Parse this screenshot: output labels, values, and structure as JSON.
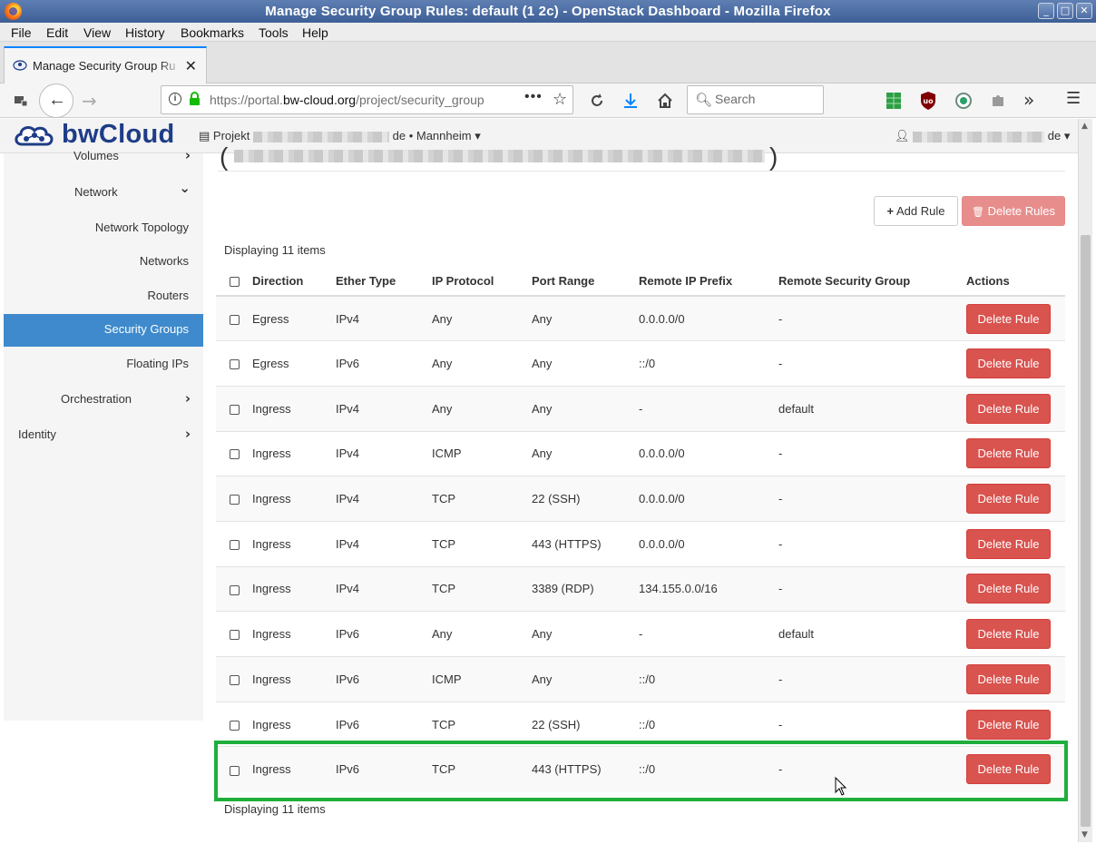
{
  "window": {
    "title": "Manage Security Group Rules: default (1                              2c) - OpenStack Dashboard - Mozilla Firefox",
    "buttons": [
      "_",
      "□",
      "✕"
    ]
  },
  "menubar": [
    "File",
    "Edit",
    "View",
    "History",
    "Bookmarks",
    "Tools",
    "Help"
  ],
  "tab": {
    "title": "Manage Security Group Ru",
    "close": "✕"
  },
  "navbar": {
    "url_prefix": "https://portal.",
    "url_host": "bw-cloud.org",
    "url_path": "/project/security_group",
    "search_placeholder": "Search",
    "icons": [
      "back-icon",
      "forward-icon",
      "page-info-icon",
      "lock-icon",
      "page-actions-icon",
      "bookmark-star-icon",
      "reload-icon",
      "downloads-icon",
      "home-icon",
      "search-icon",
      "spreadsheet-extension-icon",
      "ublock-icon",
      "extension-circle-icon",
      "extension-puzzle-icon",
      "overflow-icon",
      "hamburger-menu-icon"
    ]
  },
  "app": {
    "logo": "bwCloud",
    "project_prefix": "Projekt",
    "project_suffix": "de • Mannheim",
    "user_suffix": "de",
    "caret": "▾"
  },
  "sidebar": {
    "items": [
      {
        "label": "Volumes",
        "chevron": "›"
      },
      {
        "label": "Network",
        "chevron": "⌄"
      },
      {
        "label": "Network Topology"
      },
      {
        "label": "Networks"
      },
      {
        "label": "Routers"
      },
      {
        "label": "Security Groups"
      },
      {
        "label": "Floating IPs"
      },
      {
        "label": "Orchestration",
        "chevron": "›"
      },
      {
        "label": "Identity",
        "chevron": "›"
      }
    ]
  },
  "main": {
    "add_rule": "Add Rule",
    "delete_rules": "Delete Rules",
    "count_top": "Displaying 11 items",
    "count_bottom": "Displaying 11 items",
    "columns": [
      "Direction",
      "Ether Type",
      "IP Protocol",
      "Port Range",
      "Remote IP Prefix",
      "Remote Security Group",
      "Actions"
    ],
    "row_action": "Delete Rule",
    "rows": [
      [
        "Egress",
        "IPv4",
        "Any",
        "Any",
        "0.0.0.0/0",
        "-"
      ],
      [
        "Egress",
        "IPv6",
        "Any",
        "Any",
        "::/0",
        "-"
      ],
      [
        "Ingress",
        "IPv4",
        "Any",
        "Any",
        "-",
        "default"
      ],
      [
        "Ingress",
        "IPv4",
        "ICMP",
        "Any",
        "0.0.0.0/0",
        "-"
      ],
      [
        "Ingress",
        "IPv4",
        "TCP",
        "22 (SSH)",
        "0.0.0.0/0",
        "-"
      ],
      [
        "Ingress",
        "IPv4",
        "TCP",
        "443 (HTTPS)",
        "0.0.0.0/0",
        "-"
      ],
      [
        "Ingress",
        "IPv4",
        "TCP",
        "3389 (RDP)",
        "134.155.0.0/16",
        "-"
      ],
      [
        "Ingress",
        "IPv6",
        "Any",
        "Any",
        "-",
        "default"
      ],
      [
        "Ingress",
        "IPv6",
        "ICMP",
        "Any",
        "::/0",
        "-"
      ],
      [
        "Ingress",
        "IPv6",
        "TCP",
        "22 (SSH)",
        "::/0",
        "-"
      ],
      [
        "Ingress",
        "IPv6",
        "TCP",
        "443 (HTTPS)",
        "::/0",
        "-"
      ]
    ]
  },
  "colors": {
    "active_nav": "#3e8acc",
    "danger": "#d9534f",
    "danger_disabled": "#e78e8c",
    "highlight": "#1fae3c",
    "brand": "#1e3c87"
  }
}
